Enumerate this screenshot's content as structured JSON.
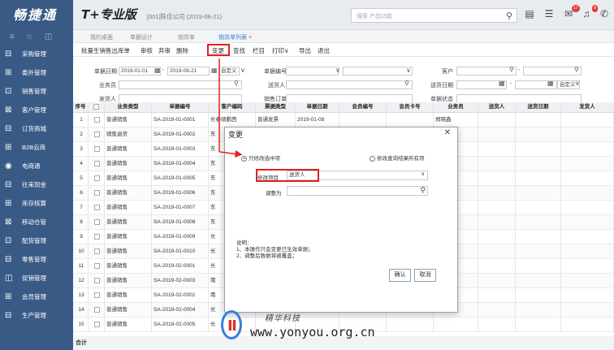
{
  "header": {
    "logo": "畅捷通",
    "product": "T+专业版",
    "company": "[001]陈佳公司  (2019-08-21)",
    "search_placeholder": "搜索 产品功能",
    "badge1": "17",
    "badge2": "9"
  },
  "sidebar": {
    "items": [
      {
        "label": "采购管理"
      },
      {
        "label": "委外管理"
      },
      {
        "label": "销售管理"
      },
      {
        "label": "客户管理"
      },
      {
        "label": "订货商城"
      },
      {
        "label": "B2B云商"
      },
      {
        "label": "电商通"
      },
      {
        "label": "往来现金"
      },
      {
        "label": "库存核算"
      },
      {
        "label": "移动仓管"
      },
      {
        "label": "配货管理"
      },
      {
        "label": "零售管理"
      },
      {
        "label": "促销管理"
      },
      {
        "label": "会员管理"
      },
      {
        "label": "生产管理"
      }
    ]
  },
  "tabs": [
    {
      "label": "我的桌面"
    },
    {
      "label": "单据设计"
    },
    {
      "label": "销货单"
    },
    {
      "label": "销货单列表"
    }
  ],
  "toolbar": {
    "items": [
      "批量生销售出库单",
      "审核",
      "弃审",
      "删除",
      "变更",
      "查找",
      "栏目",
      "打印∨",
      "导出",
      "退出"
    ]
  },
  "filter": {
    "date_label": "单据日期",
    "date_from": "2019-01-01",
    "date_to": "2019-08-21",
    "date_mode": "自定义",
    "code_label": "单据编号",
    "customer_label": "客户",
    "salesman_label": "业务员",
    "deliverer_label": "送货人",
    "delivery_date_label": "送货日期",
    "delivery_date_mode": "自定义",
    "deliver_label": "发货人",
    "sales_order_label": "销售订单号",
    "doc_status_label": "单据状态"
  },
  "grid": {
    "headers": [
      "序号",
      "",
      "业务类型",
      "单据编号",
      "客户编码",
      "票据类型",
      "单据日期",
      "会员编号",
      "会员卡号",
      "业务员",
      "送货人",
      "送货日期",
      "发货人"
    ],
    "rows": [
      [
        "1",
        "普通销售",
        "SA-2019-01-0001",
        "长春硕鹏西",
        "普通发票",
        "2019-01-08",
        "",
        "",
        "郑晓鑫"
      ],
      [
        "2",
        "销售退货",
        "SA-2019-01-0002",
        "东",
        "",
        "",
        "",
        "",
        ""
      ],
      [
        "3",
        "普通销售",
        "SA-2019-01-0003",
        "东",
        "",
        "",
        "",
        "",
        ""
      ],
      [
        "4",
        "普通销售",
        "SA-2019-01-0004",
        "东",
        "",
        "",
        "",
        "",
        ""
      ],
      [
        "5",
        "普通销售",
        "SA-2019-01-0005",
        "东",
        "",
        "",
        "",
        "",
        ""
      ],
      [
        "6",
        "普通销售",
        "SA-2019-01-0006",
        "东",
        "",
        "",
        "",
        "",
        ""
      ],
      [
        "7",
        "普通销售",
        "SA-2019-01-0007",
        "东",
        "",
        "",
        "",
        "",
        ""
      ],
      [
        "8",
        "普通销售",
        "SA-2019-01-0008",
        "东",
        "",
        "",
        "",
        "",
        ""
      ],
      [
        "9",
        "普通销售",
        "SA-2019-01-0009",
        "长",
        "",
        "",
        "",
        "",
        ""
      ],
      [
        "10",
        "普通销售",
        "SA-2019-01-0010",
        "长",
        "",
        "",
        "",
        "",
        ""
      ],
      [
        "11",
        "普通销售",
        "SA-2019-02-0001",
        "长",
        "",
        "",
        "",
        "",
        ""
      ],
      [
        "12",
        "普通销售",
        "SA-2019-02-0003",
        "南",
        "",
        "",
        "",
        "",
        ""
      ],
      [
        "13",
        "普通销售",
        "SA-2019-02-0002",
        "南",
        "",
        "",
        "",
        "",
        ""
      ],
      [
        "14",
        "普通销售",
        "SA-2019-02-0004",
        "长",
        "",
        "",
        "",
        "",
        ""
      ],
      [
        "15",
        "普通销售",
        "SA-2019-02-0005",
        "长",
        "",
        "",
        "",
        "",
        ""
      ]
    ],
    "footer": "合计"
  },
  "modal": {
    "title": "变更",
    "radio1": "只修改选中项",
    "radio2": "修改查询结果所有项",
    "field_label": "修改项目",
    "field_value": "送货人",
    "adjust_label": "调整为",
    "note_line1": "说明：",
    "note_line2": "1、本操作只会变更已生效单据；",
    "note_line3": "2、调整后数据将被覆盖；",
    "ok": "确认",
    "cancel": "取消"
  },
  "watermark": {
    "cn": "精华科技",
    "url": "www.yonyou.org.cn"
  }
}
